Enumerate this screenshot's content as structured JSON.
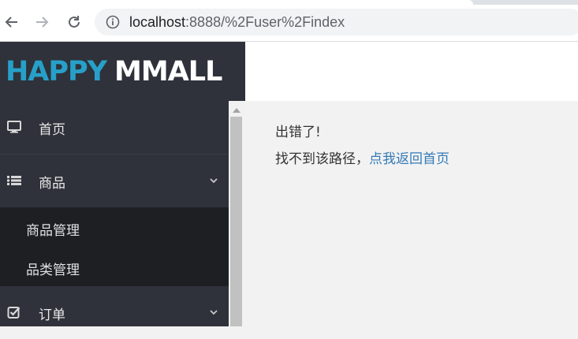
{
  "browser": {
    "url_host": "localhost",
    "url_path": ":8888/%2Fuser%2Findex",
    "icons": [
      "back-arrow-icon",
      "forward-arrow-icon",
      "reload-icon",
      "info-icon"
    ]
  },
  "brand": {
    "part1": "HAPPY",
    "part2": "MMALL",
    "accent_color": "#27a0c9"
  },
  "sidebar": {
    "items": [
      {
        "label": "首页",
        "icon": "desktop-icon"
      },
      {
        "label": "商品",
        "icon": "list-icon",
        "expanded": true,
        "children": [
          {
            "label": "商品管理"
          },
          {
            "label": "品类管理"
          }
        ]
      },
      {
        "label": "订单",
        "icon": "check-square-icon",
        "expanded": false
      }
    ]
  },
  "main": {
    "error_title": "出错了!",
    "error_msg": "找不到该路径，",
    "back_link": "点我返回首页",
    "link_color": "#337ab7"
  }
}
